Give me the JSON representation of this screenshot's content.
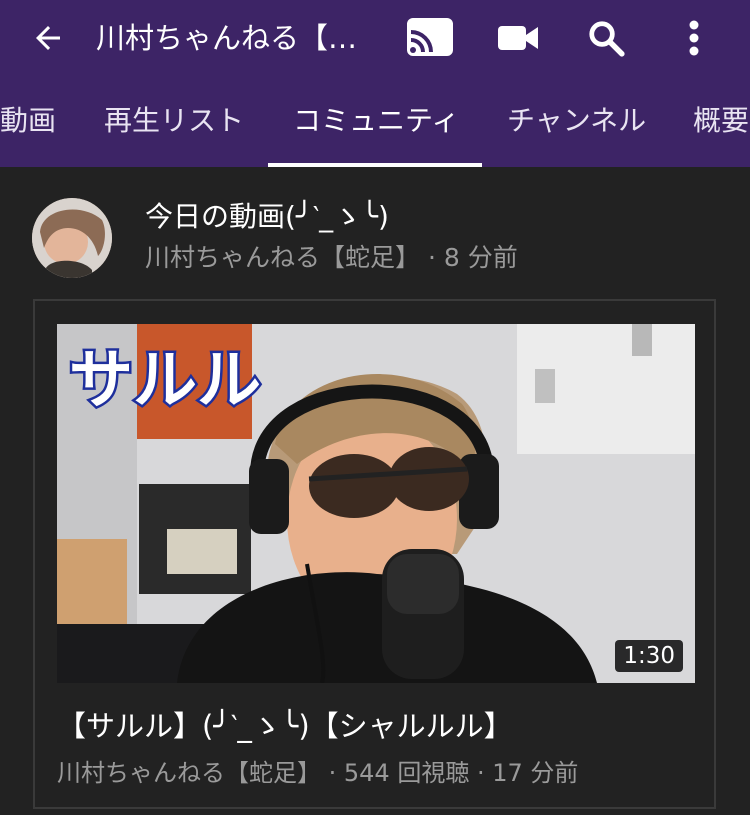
{
  "topbar": {
    "title": "川村ちゃんねる【…",
    "icons": [
      "back-arrow-icon",
      "cast-icon",
      "camera-icon",
      "search-icon",
      "more-vert-icon"
    ]
  },
  "tabs": [
    {
      "label": "動画"
    },
    {
      "label": "再生リスト"
    },
    {
      "label": "コミュニティ",
      "active": true
    },
    {
      "label": "チャンネル"
    },
    {
      "label": "概要"
    }
  ],
  "post": {
    "title": "今日の動画(╯‵_ゝ╰)",
    "meta": "川村ちゃんねる【蛇足】 · 8 分前"
  },
  "video": {
    "thumb_text": "サルル",
    "duration": "1:30",
    "title": "【サルル】(╯‵_ゝ╰)【シャルルル】",
    "meta": "川村ちゃんねる【蛇足】 · 544 回視聴 · 17 分前"
  },
  "colors": {
    "appbar": "#3d2466",
    "background": "#222222",
    "secondary_text": "#9a9a9a"
  }
}
